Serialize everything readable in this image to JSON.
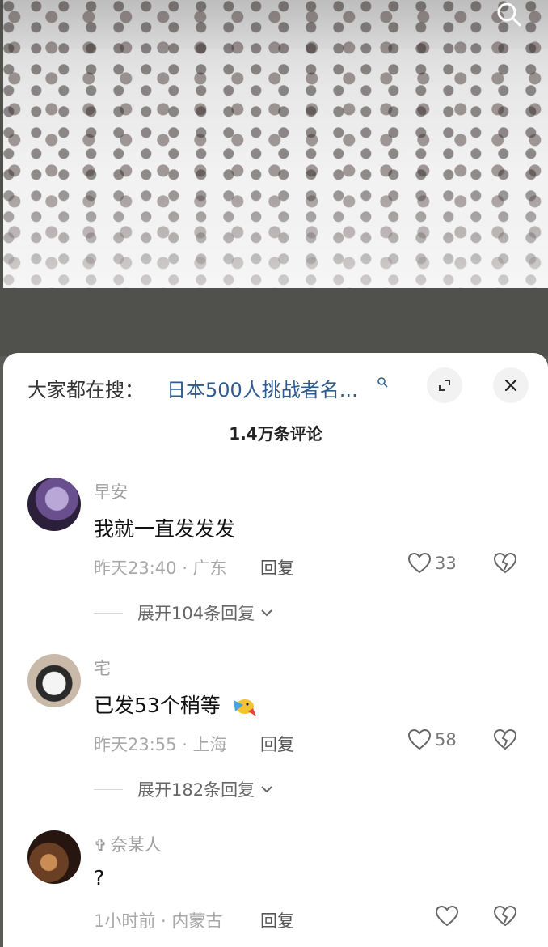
{
  "header": {
    "search_prefix": "大家都在搜：",
    "search_term": "日本500人挑战者名...",
    "comment_count": "1.4万条评论"
  },
  "comments": [
    {
      "username": "早安",
      "text": "我就一直发发发",
      "meta": "昨天23:40 · 广东",
      "reply": "回复",
      "likes": "33",
      "expand": "展开104条回复"
    },
    {
      "username": "宅",
      "text": "已发53个稍等",
      "meta": "昨天23:55 · 上海",
      "reply": "回复",
      "likes": "58",
      "expand": "展开182条回复"
    },
    {
      "username": "奈某人",
      "username_prefix": "✞",
      "text": "?",
      "meta": "1小时前 · 内蒙古",
      "reply": "回复",
      "likes": ""
    }
  ],
  "icons": {
    "search": "search-icon",
    "expand": "expand-icon",
    "close": "close-icon",
    "like": "heart-icon",
    "dislike": "broken-heart-icon",
    "chevron": "chevron-down-icon"
  },
  "colors": {
    "link": "#2f5c8f",
    "muted": "#a8a8a8"
  }
}
